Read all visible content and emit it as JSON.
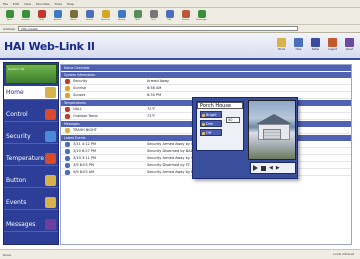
{
  "browser": {
    "menu": [
      "File",
      "Edit",
      "View",
      "Favorites",
      "Tools",
      "Help"
    ],
    "toolbar": [
      {
        "label": "Back",
        "color": "#3b8f3b"
      },
      {
        "label": "Forward",
        "color": "#3b8f3b"
      },
      {
        "label": "Stop",
        "color": "#c0392b"
      },
      {
        "label": "Refresh",
        "color": "#3c7bc2"
      },
      {
        "label": "Home",
        "color": "#7a6f3b"
      },
      {
        "label": "Search",
        "color": "#4a6fb8"
      },
      {
        "label": "Favorites",
        "color": "#d6a62a"
      },
      {
        "label": "History",
        "color": "#3c7bc2"
      },
      {
        "label": "Mail",
        "color": "#5a8c5a"
      },
      {
        "label": "Print",
        "color": "#777777"
      },
      {
        "label": "Edit",
        "color": "#4a6fb8"
      },
      {
        "label": "Discuss",
        "color": "#b85a3b"
      },
      {
        "label": "Messenger",
        "color": "#3b8f3b"
      }
    ],
    "address_label": "Address",
    "address_value": "http://webl/",
    "status_text": "Done",
    "status_zone": "Local intranet"
  },
  "app": {
    "logo": "HAI Web-Link II",
    "header_icons": [
      {
        "label": "Home",
        "color": "#d7b24a"
      },
      {
        "label": "Help",
        "color": "#4a6fb8"
      },
      {
        "label": "Setup",
        "color": "#3a4ca0"
      },
      {
        "label": "Logout",
        "color": "#c45a2a"
      },
      {
        "label": "About",
        "color": "#6b4aa0"
      }
    ],
    "side_banner": "System OK",
    "nav": [
      {
        "label": "Home",
        "active": true,
        "color": "#d7b24a"
      },
      {
        "label": "Control",
        "active": false,
        "color": "#d84a2a"
      },
      {
        "label": "Security",
        "active": false,
        "color": "#4a8ad8"
      },
      {
        "label": "Temperature",
        "active": false,
        "color": "#d84a2a"
      },
      {
        "label": "Button",
        "active": false,
        "color": "#d7b24a"
      },
      {
        "label": "Events",
        "active": false,
        "color": "#d7b24a"
      },
      {
        "label": "Messages",
        "active": false,
        "color": "#6b3fa0"
      }
    ]
  },
  "main": {
    "title": "Home Overview",
    "system_header": "System Information",
    "system_rows": [
      {
        "label": "Security",
        "value": "Armed Away",
        "icon_color": "#c0392b"
      },
      {
        "label": "Sunrise",
        "value": "6:58 AM",
        "icon_color": "#e0a020"
      },
      {
        "label": "Sunset",
        "value": "6:30 PM",
        "icon_color": "#e0a020"
      }
    ],
    "temp_header": "Temperatures",
    "temp_rows": [
      {
        "label": "HALL",
        "value": "72°F",
        "icon_color": "#c0392b"
      },
      {
        "label": "Outdoor Temp",
        "value": "72°F",
        "icon_color": "#c0392b"
      }
    ],
    "msg_header": "Messages",
    "msg_rows": [
      {
        "label": "TRASH NIGHT",
        "value": "",
        "icon_color": "#d7b24a"
      }
    ],
    "events_header": "Latest Events",
    "event_rows": [
      {
        "time": "3/11 4:12 PM",
        "text": "Security Armed Away by WOAH",
        "icon_color": "#4a6fb8"
      },
      {
        "time": "3/10 6:27 PM",
        "text": "Security Disarmed by BAD",
        "icon_color": "#4a6fb8"
      },
      {
        "time": "3/10 3:11 PM",
        "text": "Security Armed Away by SAM",
        "icon_color": "#4a6fb8"
      },
      {
        "time": "3/9 8:03 PM",
        "text": "Security Disarmed by FT. Access",
        "icon_color": "#4a6fb8"
      },
      {
        "time": "3/9 8:03 AM",
        "text": "Security Armed Away by FD Access",
        "icon_color": "#4a6fb8"
      }
    ]
  },
  "overlay": {
    "title": "Porch House",
    "buttons": [
      "Bright",
      "Dim",
      "Off"
    ],
    "level_value": "50",
    "player_controls": [
      "play",
      "stop",
      "previous",
      "next"
    ]
  }
}
